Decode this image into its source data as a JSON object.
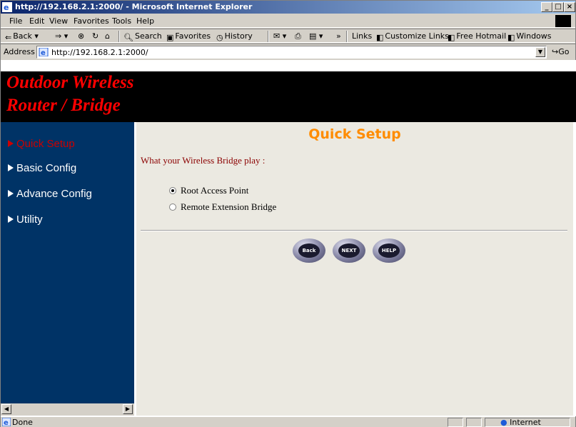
{
  "window": {
    "title": "http://192.168.2.1:2000/ - Microsoft Internet Explorer",
    "min_label": "_",
    "max_label": "□",
    "close_label": "×"
  },
  "menu": [
    {
      "label": "File"
    },
    {
      "label": "Edit"
    },
    {
      "label": "View"
    },
    {
      "label": "Favorites"
    },
    {
      "label": "Tools"
    },
    {
      "label": "Help"
    }
  ],
  "toolbar": {
    "back": "Back",
    "search": "Search",
    "favorites": "Favorites",
    "history": "History",
    "more": "»",
    "links": "Links",
    "customize_links": "Customize Links",
    "free_hotmail": "Free Hotmail",
    "windows": "Windows"
  },
  "address": {
    "label": "Address",
    "url": "http://192.168.2.1:2000/",
    "go": "Go"
  },
  "banner": {
    "line1": "Outdoor Wireless",
    "line2": "Router / Bridge"
  },
  "sidebar": {
    "items": [
      {
        "label": "Quick Setup",
        "active": true
      },
      {
        "label": "Basic Config",
        "active": false
      },
      {
        "label": "Advance Config",
        "active": false
      },
      {
        "label": "Utility",
        "active": false
      }
    ]
  },
  "main": {
    "title": "Quick Setup",
    "question": "What your Wireless Bridge play :",
    "options": [
      {
        "label": "Root Access Point",
        "selected": true
      },
      {
        "label": "Remote Extension Bridge",
        "selected": false
      }
    ],
    "buttons": {
      "back": "Back",
      "next": "NEXT",
      "help": "HELP"
    }
  },
  "status": {
    "text": "Done",
    "zone": "Internet"
  },
  "colors": {
    "banner_text": "#ff0000",
    "sidebar_bg": "#003366",
    "active_nav": "#cc0000",
    "title": "#ff8c00",
    "question": "#8b0000"
  }
}
